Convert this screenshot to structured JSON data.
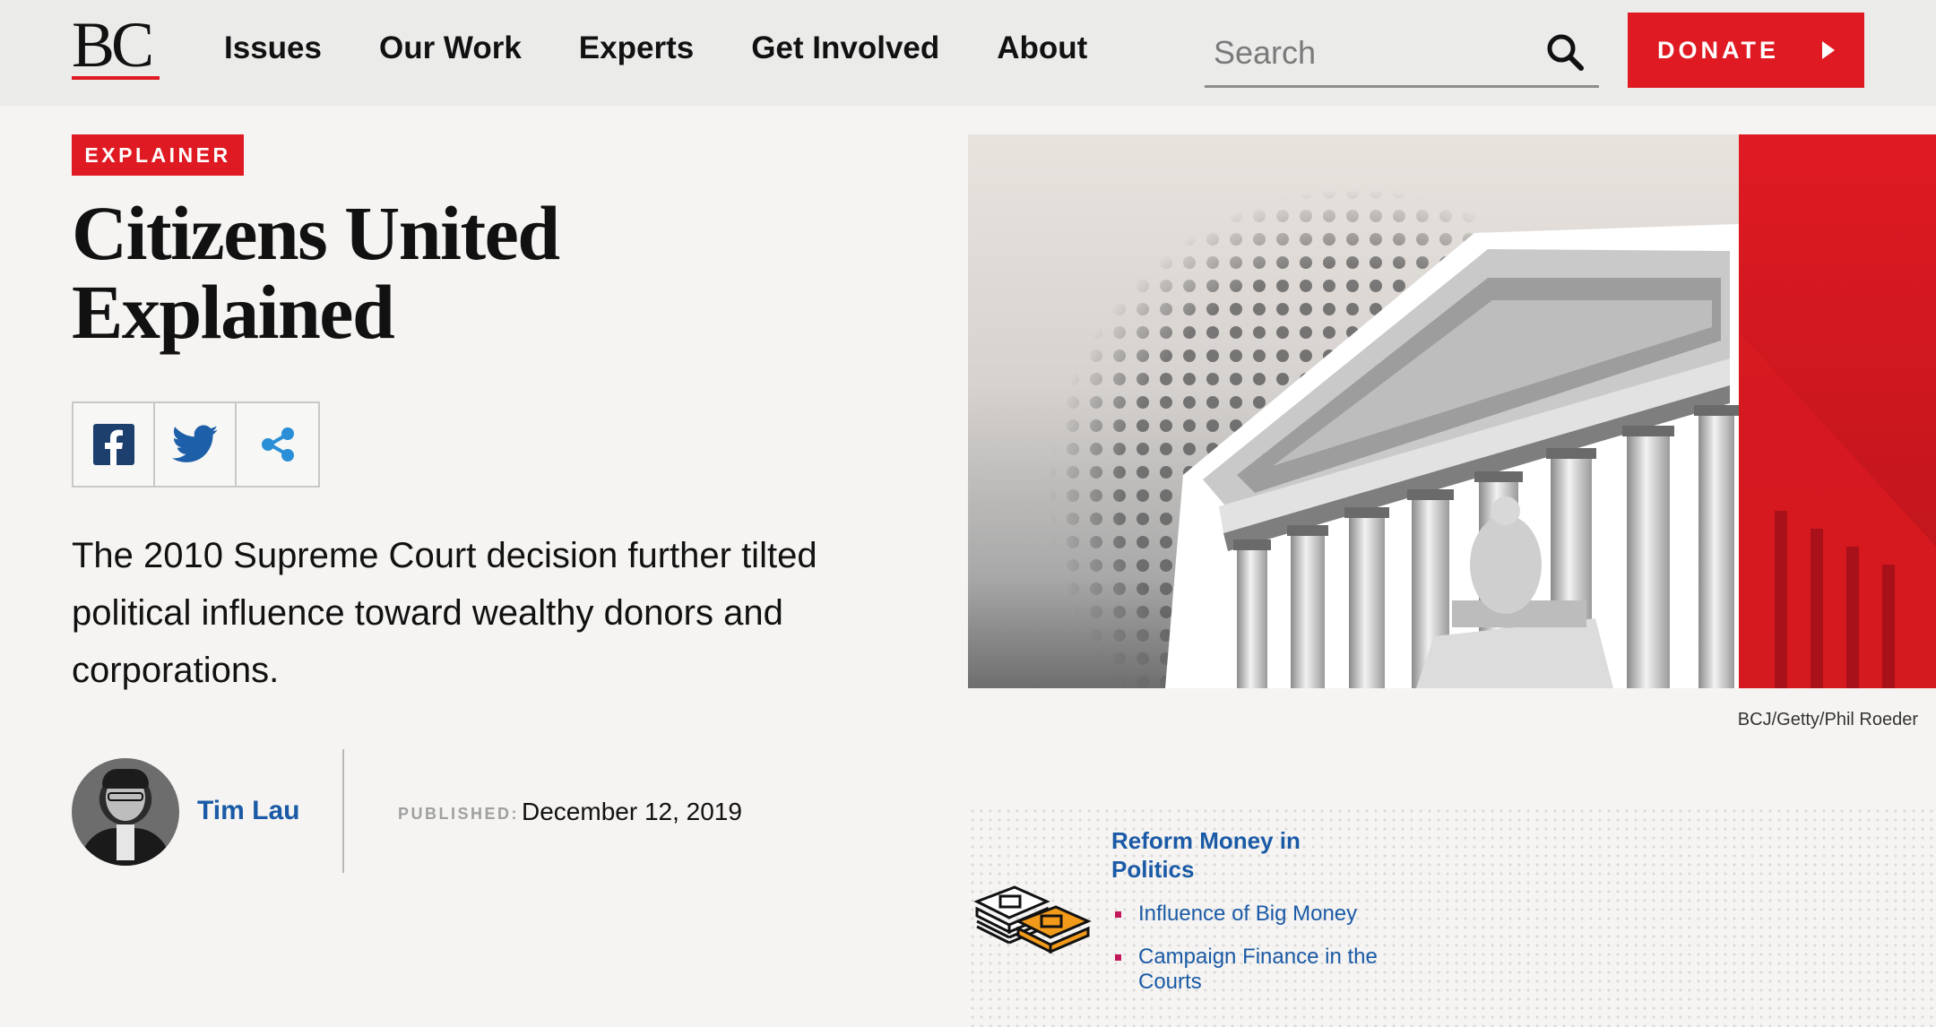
{
  "header": {
    "logo_text": "BC",
    "nav": [
      "Issues",
      "Our Work",
      "Experts",
      "Get Involved",
      "About"
    ],
    "search_placeholder": "Search",
    "donate_label": "DONATE"
  },
  "article": {
    "badge": "EXPLAINER",
    "title": "Citizens United Explained",
    "dek": "The 2010 Supreme Court decision further tilted political influence toward wealthy donors and corporations.",
    "author": "Tim Lau",
    "published_label": "PUBLISHED:",
    "published_date": "December 12, 2019",
    "image_credit": "BCJ/Getty/Phil Roeder"
  },
  "share": {
    "icons": [
      "facebook-icon",
      "twitter-icon",
      "share-icon"
    ]
  },
  "topics": {
    "title": "Reform Money in Politics",
    "links": [
      "Influence of Big Money",
      "Campaign Finance in the Courts"
    ]
  },
  "colors": {
    "brand_red": "#e01a22",
    "link_blue": "#1a5aa6",
    "bullet_pink": "#c2185b"
  }
}
